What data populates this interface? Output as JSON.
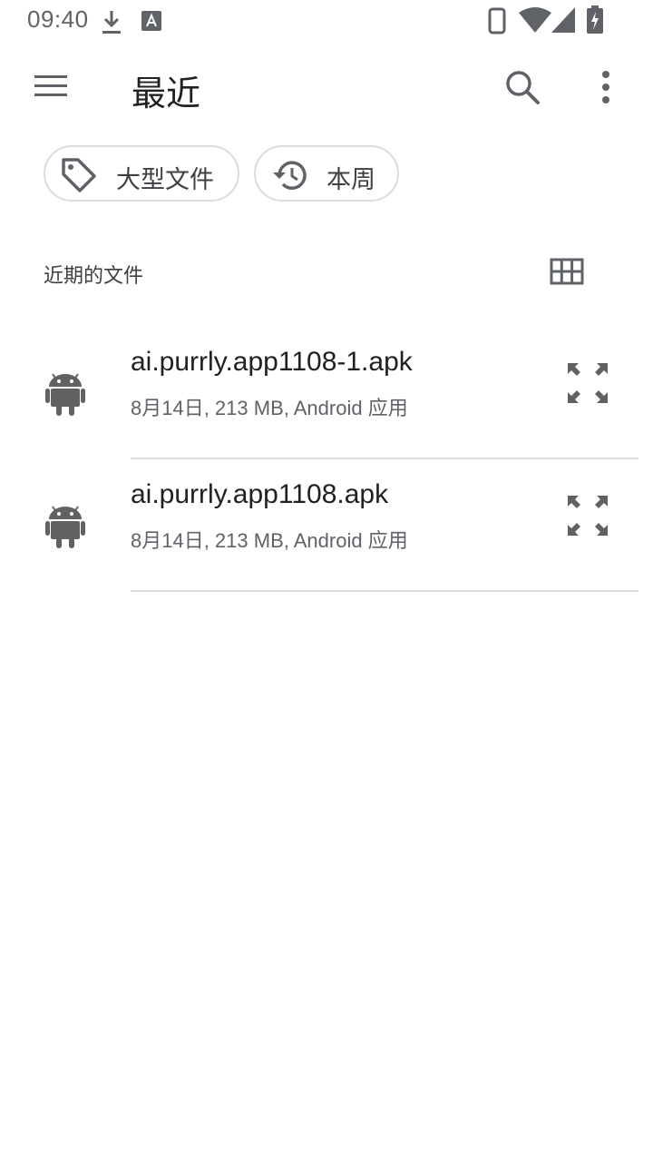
{
  "status_bar": {
    "time": "09:40",
    "icons": [
      "download-icon",
      "a-notification-icon",
      "phone-icon",
      "wifi-icon",
      "signal-icon",
      "battery-charging-icon"
    ]
  },
  "app_bar": {
    "title": "最近",
    "icons": [
      "menu-icon",
      "search-icon",
      "more-vert-icon"
    ]
  },
  "chips": [
    {
      "label": "大型文件",
      "icon": "tag-icon"
    },
    {
      "label": "本周",
      "icon": "history-icon"
    }
  ],
  "section": {
    "title": "近期的文件",
    "toggle_icon": "grid-view-icon"
  },
  "files": [
    {
      "name": "ai.purrly.app1108-1.apk",
      "meta": "8月14日, 213 MB, Android 应用",
      "icon": "android-icon"
    },
    {
      "name": "ai.purrly.app1108.apk",
      "meta": "8月14日, 213 MB, Android 应用",
      "icon": "android-icon"
    }
  ],
  "colors": {
    "primary_text": "#202124",
    "secondary_text": "#5f6368",
    "icon_gray": "#616161",
    "divider": "#dadce0"
  }
}
